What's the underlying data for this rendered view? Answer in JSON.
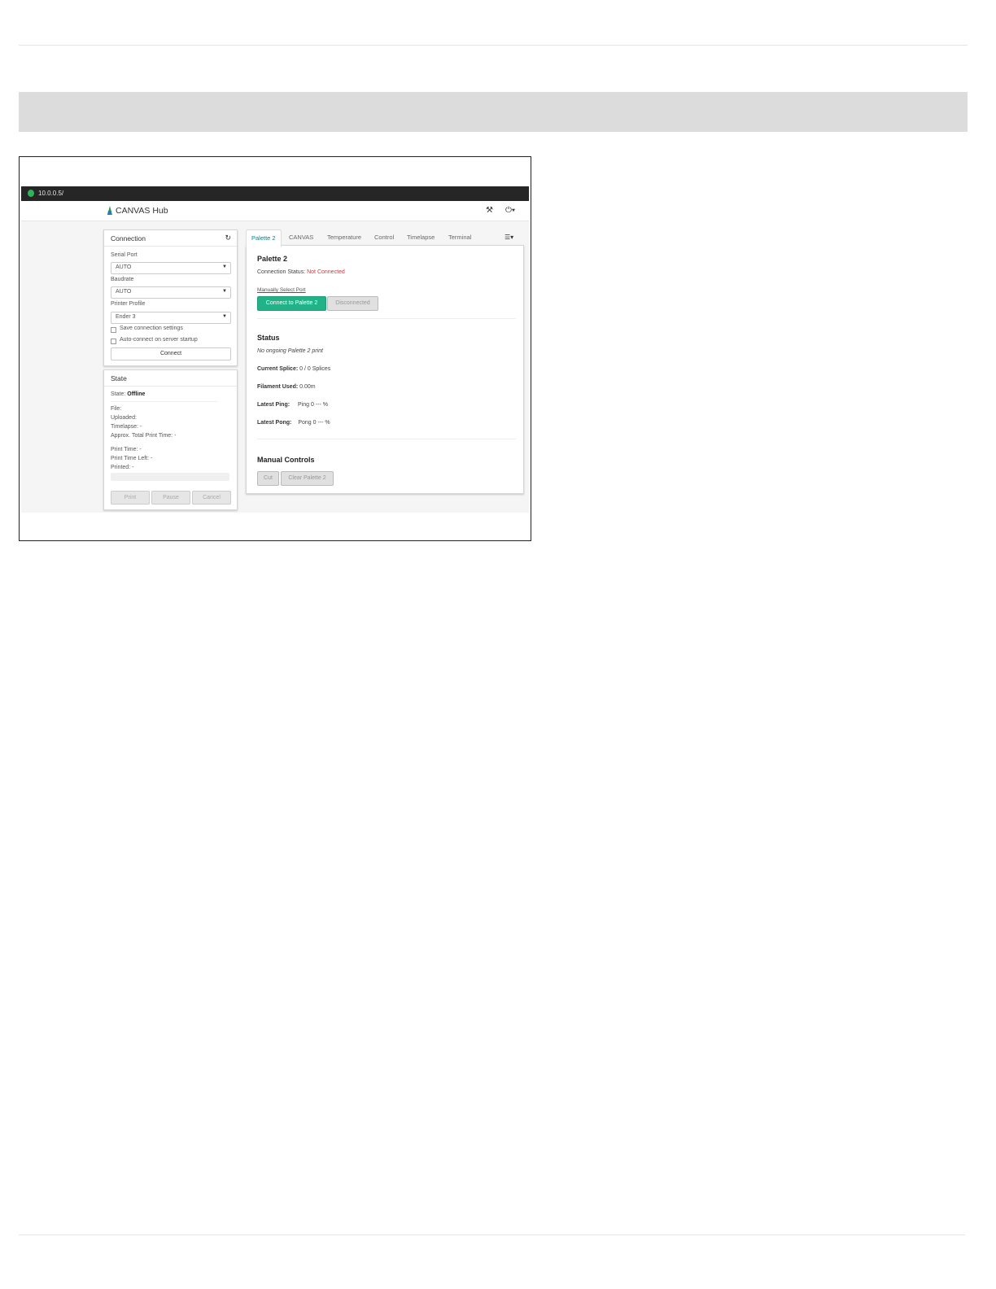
{
  "browser": {
    "url": "10.0.0.5/"
  },
  "navbar": {
    "brand": "CANVAS Hub",
    "settings_icon": "wrench-icon",
    "system_icon": "power-icon"
  },
  "connection": {
    "title": "Connection",
    "serial_port_label": "Serial Port",
    "serial_port_value": "AUTO",
    "baudrate_label": "Baudrate",
    "baudrate_value": "AUTO",
    "printer_profile_label": "Printer Profile",
    "printer_profile_value": "Ender 3",
    "save_settings_label": "Save connection settings",
    "auto_connect_label": "Auto-connect on server startup",
    "connect_button": "Connect"
  },
  "state": {
    "title": "State",
    "state_label": "State:",
    "state_value": "Offline",
    "file": "File:",
    "uploaded": "Uploaded:",
    "timelapse": "Timelapse: -",
    "approx_total": "Approx. Total Print Time: -",
    "print_time": "Print Time: -",
    "print_time_left": "Print Time Left: -",
    "printed": "Printed: -",
    "print_button": "Print",
    "pause_button": "Pause",
    "cancel_button": "Cancel"
  },
  "tabs": [
    "Palette 2",
    "CANVAS",
    "Temperature",
    "Control",
    "Timelapse",
    "Terminal"
  ],
  "palette": {
    "title": "Palette 2",
    "connection_status_label": "Connection Status:",
    "connection_status_value": "Not Connected",
    "manual_select_link": "Manually Select Port",
    "connect_button": "Connect to Palette 2",
    "disconnect_button": "Disconnected",
    "status_title": "Status",
    "ongoing": "No ongoing Palette 2 print",
    "current_splice_label": "Current Splice:",
    "current_splice_value": "0 / 0 Splices",
    "filament_used_label": "Filament Used:",
    "filament_used_value": "0.00m",
    "latest_ping_label": "Latest Ping:",
    "latest_ping_value": "Ping 0 --- %",
    "latest_pong_label": "Latest Pong:",
    "latest_pong_value": "Pong 0 --- %",
    "manual_title": "Manual Controls",
    "cut_button": "Cut",
    "clear_button": "Clear Palette 2"
  },
  "colors": {
    "accent_green": "#21b387",
    "error_red": "#d9363e",
    "browser_bar": "#262626"
  }
}
